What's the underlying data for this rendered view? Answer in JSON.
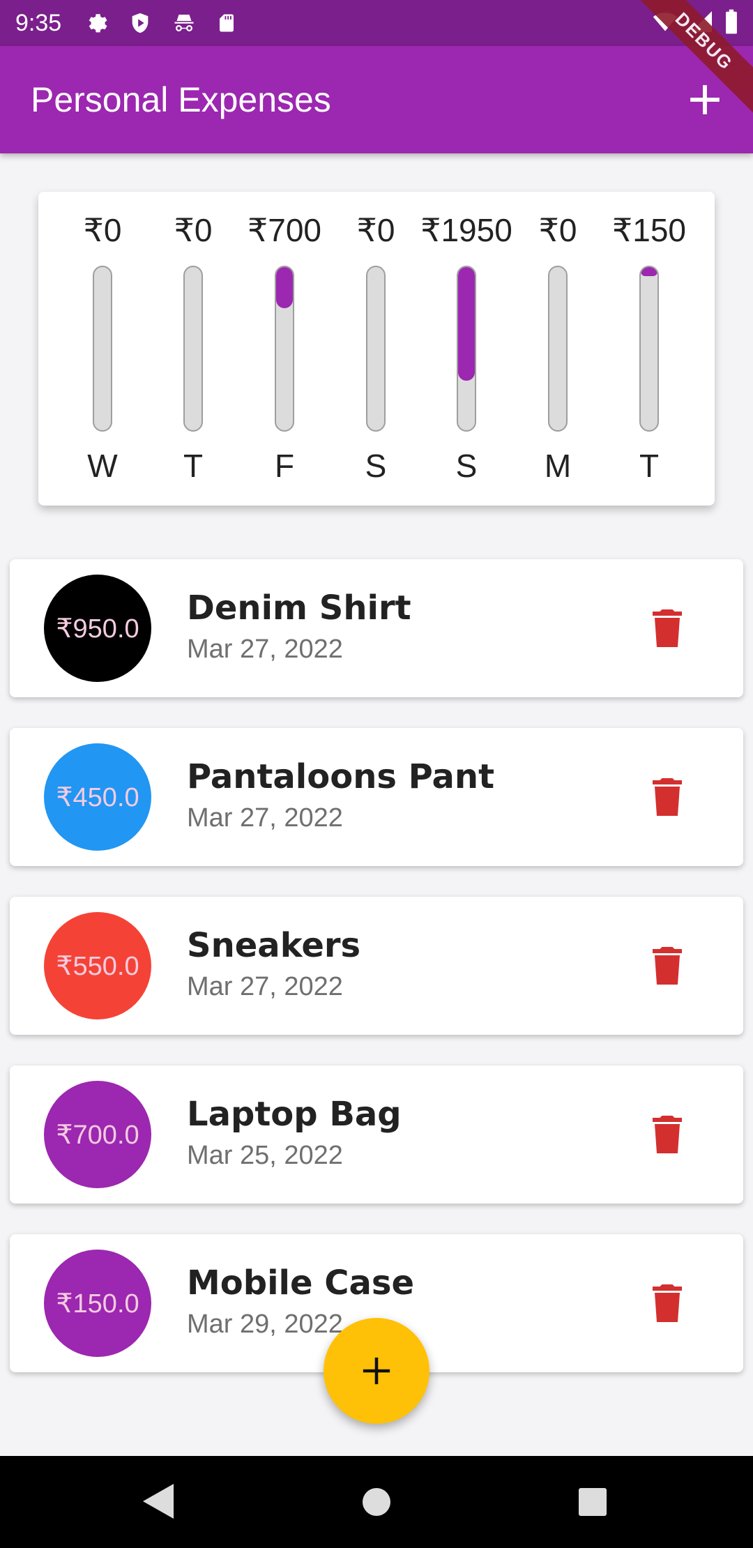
{
  "status_bar": {
    "time": "9:35",
    "icons": [
      "gear-icon",
      "shield-icon",
      "incognito-icon",
      "sd-card-icon",
      "wifi-icon",
      "signal-icon",
      "battery-icon"
    ]
  },
  "app_bar": {
    "title": "Personal Expenses",
    "add_icon": "plus-icon",
    "debug_label": "DEBUG",
    "color": "#9c27b0"
  },
  "chart_data": {
    "type": "bar",
    "categories": [
      "W",
      "T",
      "F",
      "S",
      "S",
      "M",
      "T"
    ],
    "value_labels": [
      "₹0",
      "₹0",
      "₹700",
      "₹0",
      "₹1950",
      "₹0",
      "₹150"
    ],
    "values": [
      0,
      0,
      700,
      0,
      1950,
      0,
      150
    ],
    "bar_color": "#9c27b0"
  },
  "transactions": [
    {
      "amount": "₹950.0",
      "title": "Denim Shirt",
      "date": "Mar 27, 2022",
      "color": "#000000"
    },
    {
      "amount": "₹450.0",
      "title": "Pantaloons Pant",
      "date": "Mar 27, 2022",
      "color": "#2196f3"
    },
    {
      "amount": "₹550.0",
      "title": "Sneakers",
      "date": "Mar 27, 2022",
      "color": "#f44336"
    },
    {
      "amount": "₹700.0",
      "title": "Laptop Bag",
      "date": "Mar 25, 2022",
      "color": "#9c27b0"
    },
    {
      "amount": "₹150.0",
      "title": "Mobile Case",
      "date": "Mar 29, 2022",
      "color": "#9c27b0"
    }
  ],
  "fab": {
    "icon": "plus-icon",
    "color": "#ffc107"
  },
  "nav_bar": {
    "buttons": [
      "back-icon",
      "home-icon",
      "recents-icon"
    ]
  }
}
